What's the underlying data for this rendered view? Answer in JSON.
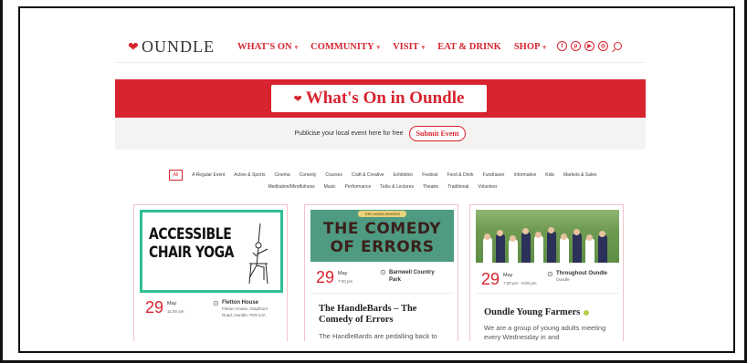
{
  "header": {
    "logo_text": "OUNDLE",
    "nav": [
      {
        "label": "WHAT'S ON",
        "caret": true
      },
      {
        "label": "COMMUNITY",
        "caret": true
      },
      {
        "label": "VISIT",
        "caret": true
      },
      {
        "label": "EAT & DRINK",
        "caret": false
      },
      {
        "label": "SHOP",
        "caret": true
      }
    ],
    "social_icons": [
      "facebook-icon",
      "pinterest-icon",
      "youtube-icon",
      "instagram-icon"
    ]
  },
  "hero": {
    "title": "What's On in Oundle"
  },
  "publicise": {
    "text": "Publicise your local event here for free",
    "button": "Submit Event"
  },
  "filters": [
    "All",
    "A Regular Event",
    "Active & Sports",
    "Cinema",
    "Comedy",
    "Courses",
    "Craft & Creative",
    "Exhibition",
    "Festival",
    "Food & Drink",
    "Fundraiser",
    "Informative",
    "Kids",
    "Markets & Sales",
    "Meditation/Mindfulness",
    "Music",
    "Performance",
    "Talks & Lectures",
    "Theatre",
    "Traditional",
    "Volunteer"
  ],
  "active_filter": "All",
  "colors": {
    "brand": "#d8242f",
    "accent_green": "#2fbf96"
  },
  "cards": [
    {
      "image_text_line1": "ACCESSIBLE",
      "image_text_line2": "CHAIR YOGA",
      "day": "29",
      "month": "May",
      "time": "11:00 am",
      "location": "Fletton House",
      "address": "Fletton House, Glapthorn Road, Oundle, PE8 4JA"
    },
    {
      "image_ribbon": "THE HANDLEBARDS",
      "image_text_line1": "THE COMEDY",
      "image_text_line2": "OF ERRORS",
      "day": "29",
      "month": "May",
      "time": "7:00 pm",
      "location": "Barnwell Country Park",
      "title": "The HandleBards – The Comedy of Errors",
      "description": "The HandleBards are pedalling back to"
    },
    {
      "day": "29",
      "month": "May",
      "time": "7:30 pm - 9:00 pm",
      "location": "Throughout Oundle",
      "address": "Oundle",
      "title": "Oundle Young Farmers",
      "description": "We are a group of young adults meeting every Wednesday in and"
    }
  ]
}
